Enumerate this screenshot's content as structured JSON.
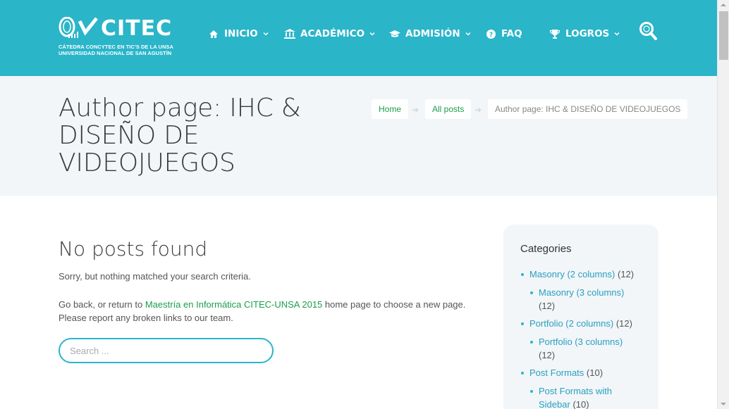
{
  "colors": {
    "header": "#2ab5c9",
    "link_green": "#1a9e4a",
    "link_blue": "#2a9fc2",
    "band": "#f2f6f8"
  },
  "logo": {
    "name": "CITEC",
    "subtitle_line1": "CÁTEDRA CONCYTEC EN TIC'S DE LA UNSA",
    "subtitle_line2": "UNIVERSIDAD NACIONAL DE SAN AGUSTÍN"
  },
  "nav": [
    {
      "label": "INICIO",
      "icon": "home-icon",
      "dropdown": true
    },
    {
      "label": "ACADÉMICO",
      "icon": "bank-icon",
      "dropdown": true
    },
    {
      "label": "ADMISIÓN",
      "icon": "graduation-cap-icon",
      "dropdown": true
    },
    {
      "label": "FAQ",
      "icon": "question-circle-icon",
      "dropdown": false
    },
    {
      "label": "LOGROS",
      "icon": "trophy-icon",
      "dropdown": true
    }
  ],
  "title": "Author page: IHC & DISEÑO DE VIDEOJUEGOS",
  "breadcrumb": {
    "home": "Home",
    "all_posts": "All posts",
    "current": "Author page: IHC & DISEÑO DE VIDEOJUEGOS"
  },
  "main": {
    "heading": "No posts found",
    "sorry": "Sorry, but nothing matched your search criteria.",
    "go_back_before": "Go back, or return to ",
    "site_link": "Maestría en Informática CITEC-UNSA 2015",
    "go_back_after": " home page to choose a new page. Please report any broken links to our team.",
    "search_placeholder": "Search ..."
  },
  "sidebar": {
    "title": "Categories",
    "categories": [
      {
        "label": "Masonry (2 columns)",
        "count": "(12)",
        "level": 0
      },
      {
        "label": "Masonry (3 columns)",
        "count": "(12)",
        "level": 1
      },
      {
        "label": "Portfolio (2 columns)",
        "count": "(12)",
        "level": 0
      },
      {
        "label": "Portfolio (3 columns)",
        "count": "(12)",
        "level": 1
      },
      {
        "label": "Post Formats",
        "count": "(10)",
        "level": 0
      },
      {
        "label": "Post Formats with Sidebar",
        "count": "(10)",
        "level": 1
      }
    ]
  }
}
